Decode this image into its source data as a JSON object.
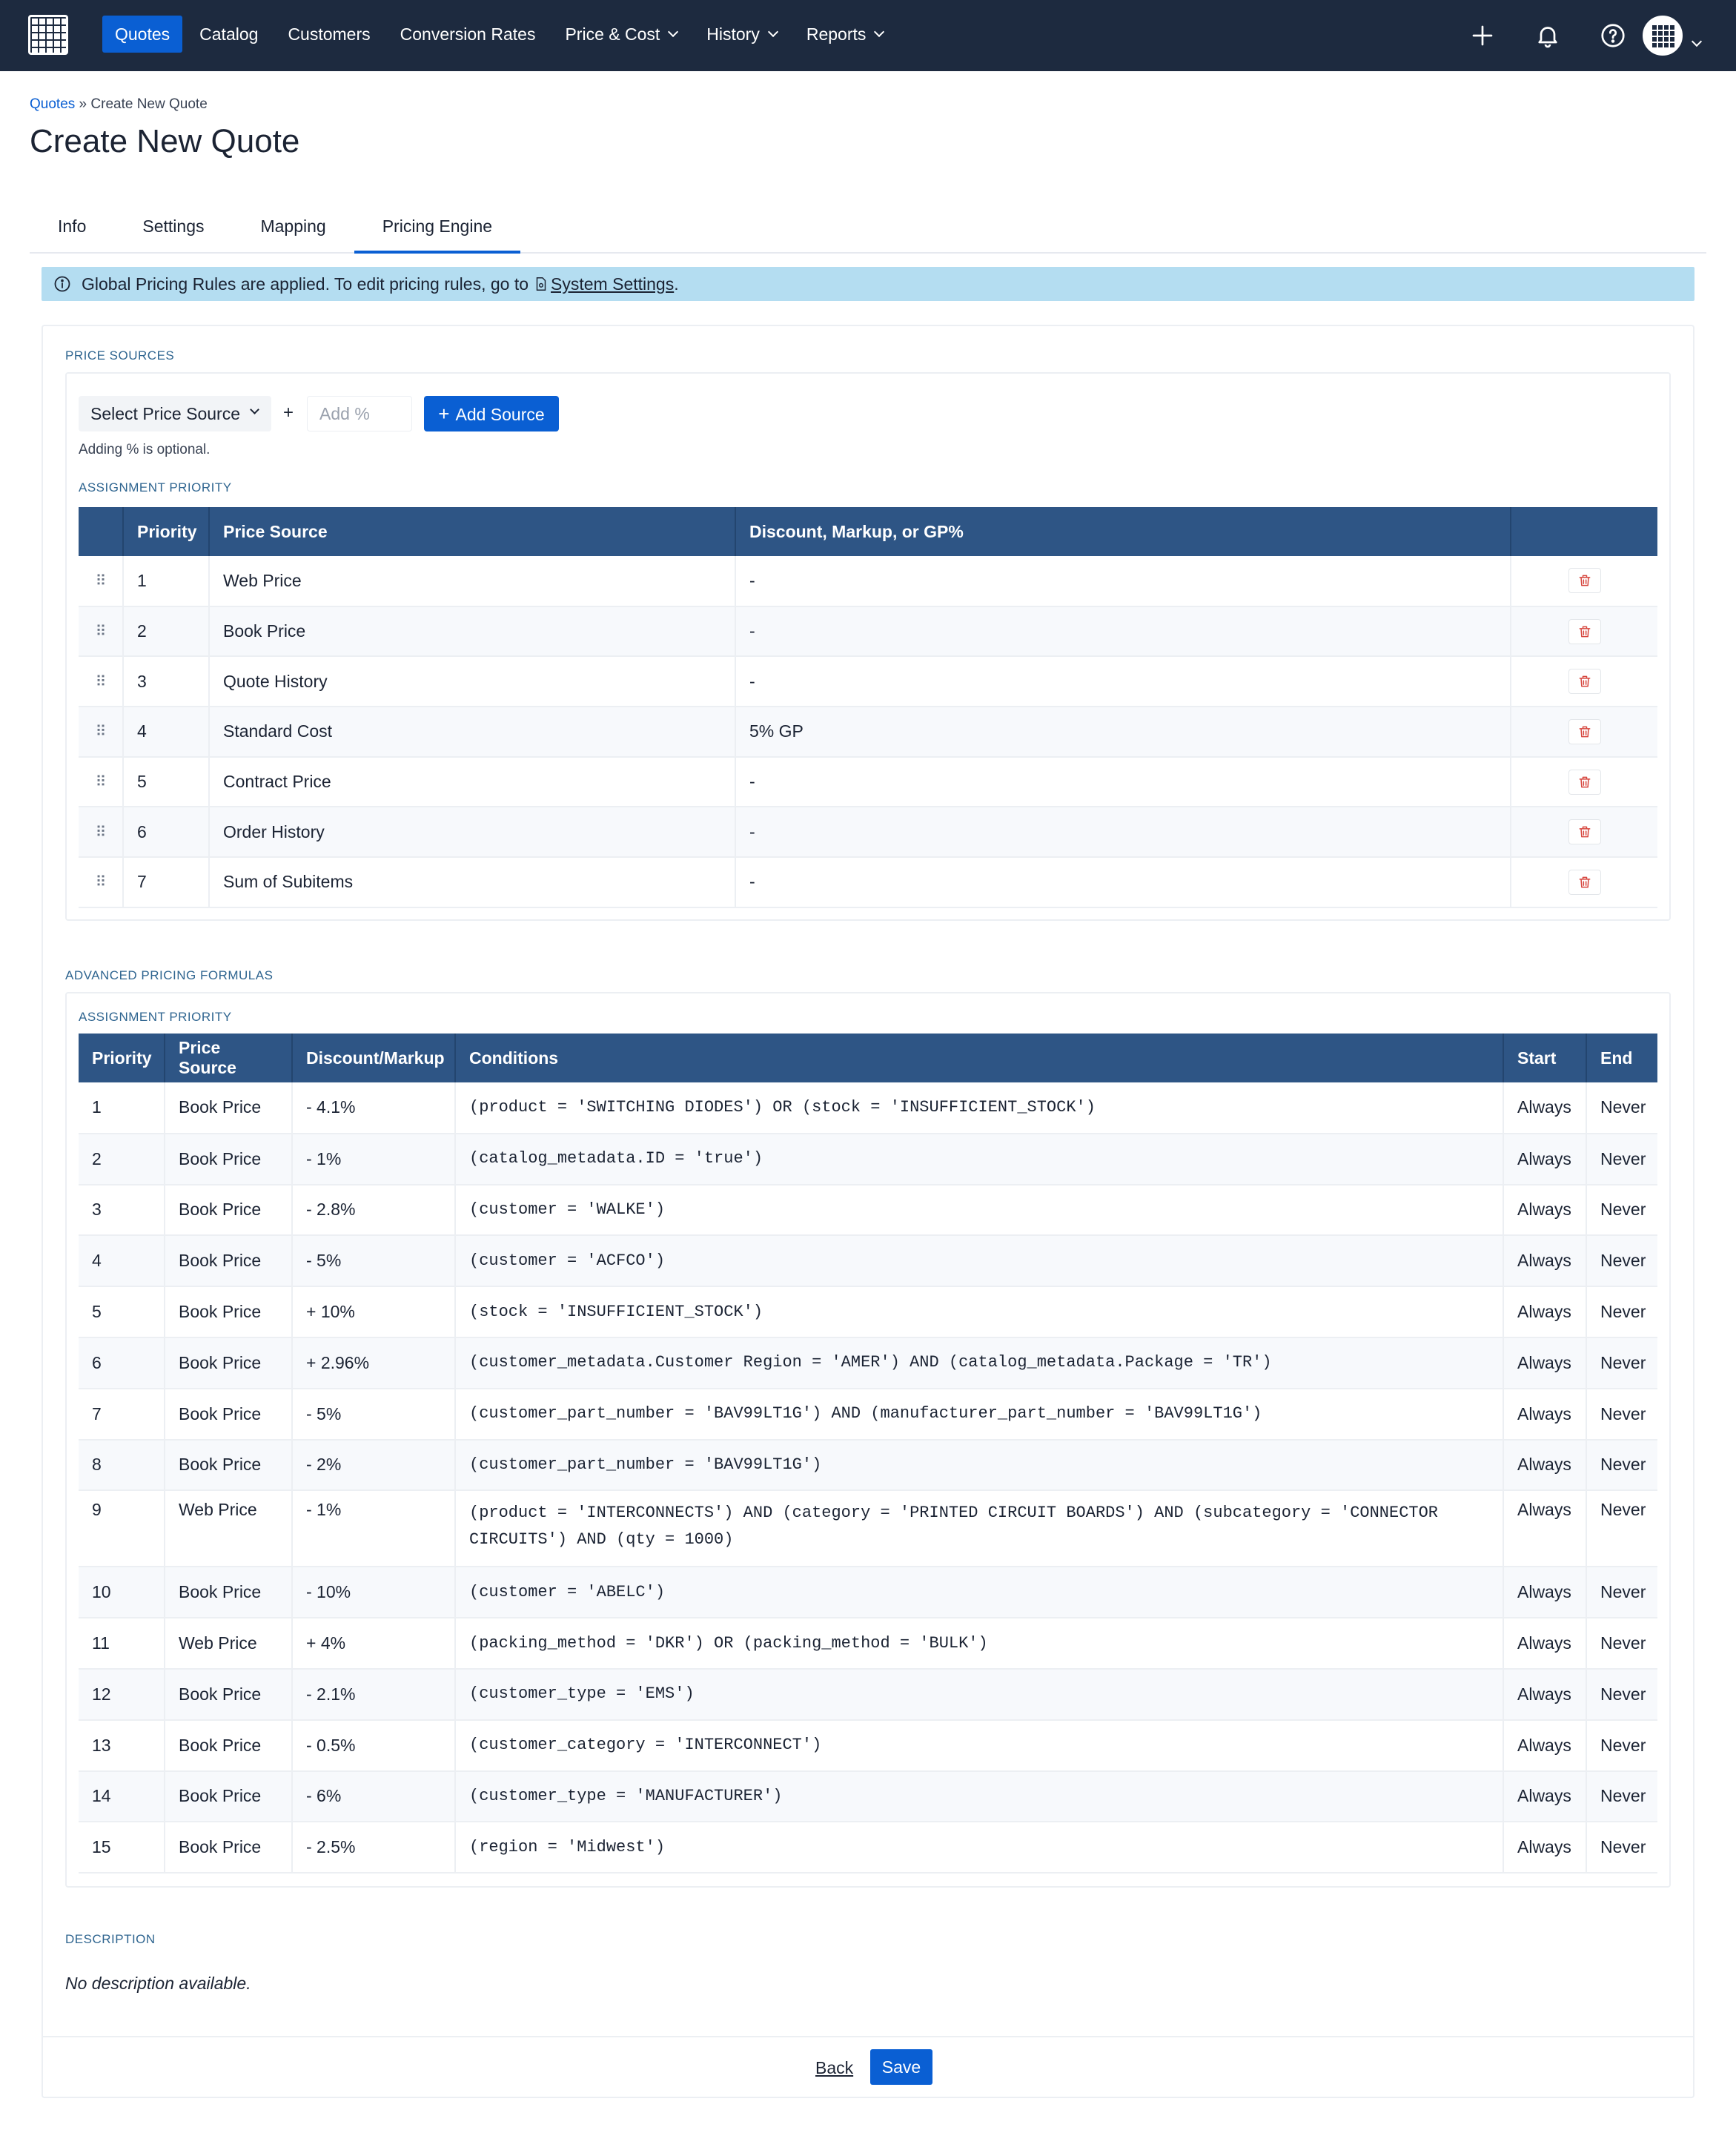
{
  "nav": {
    "items": [
      {
        "label": "Quotes",
        "active": true,
        "dropdown": false
      },
      {
        "label": "Catalog",
        "active": false,
        "dropdown": false
      },
      {
        "label": "Customers",
        "active": false,
        "dropdown": false
      },
      {
        "label": "Conversion Rates",
        "active": false,
        "dropdown": false
      },
      {
        "label": "Price & Cost",
        "active": false,
        "dropdown": true
      },
      {
        "label": "History",
        "active": false,
        "dropdown": true
      },
      {
        "label": "Reports",
        "active": false,
        "dropdown": true
      }
    ],
    "icons": [
      "plus-icon",
      "bell-icon",
      "help-icon",
      "avatar"
    ]
  },
  "breadcrumb": {
    "root": "Quotes",
    "separator": "»",
    "current": "Create New Quote"
  },
  "page_title": "Create New Quote",
  "tabs": [
    {
      "label": "Info",
      "active": false
    },
    {
      "label": "Settings",
      "active": false
    },
    {
      "label": "Mapping",
      "active": false
    },
    {
      "label": "Pricing Engine",
      "active": true
    }
  ],
  "alert": {
    "text": "Global Pricing Rules are applied. To edit pricing rules, go to",
    "link": "System Settings",
    "suffix": "."
  },
  "price_sources": {
    "label": "PRICE SOURCES",
    "select_label": "Select Price Source",
    "plus": "+",
    "add_pct_placeholder": "Add %",
    "add_button": "Add Source",
    "hint": "Adding % is optional.",
    "priority_label": "ASSIGNMENT PRIORITY",
    "columns": [
      "",
      "Priority",
      "Price Source",
      "Discount, Markup, or GP%",
      ""
    ],
    "rows": [
      {
        "priority": "1",
        "source": "Web Price",
        "adjust": "-"
      },
      {
        "priority": "2",
        "source": "Book Price",
        "adjust": "-"
      },
      {
        "priority": "3",
        "source": "Quote History",
        "adjust": "-"
      },
      {
        "priority": "4",
        "source": "Standard Cost",
        "adjust": "5% GP"
      },
      {
        "priority": "5",
        "source": "Contract Price",
        "adjust": "-"
      },
      {
        "priority": "6",
        "source": "Order History",
        "adjust": "-"
      },
      {
        "priority": "7",
        "source": "Sum of Subitems",
        "adjust": "-"
      }
    ]
  },
  "formulas": {
    "label": "ADVANCED PRICING FORMULAS",
    "priority_label": "ASSIGNMENT PRIORITY",
    "columns": [
      "Priority",
      "Price Source",
      "Discount/Markup",
      "Conditions",
      "Start",
      "End"
    ],
    "rows": [
      {
        "priority": "1",
        "source": "Book Price",
        "adjust": "- 4.1%",
        "conditions": "(product = 'SWITCHING DIODES') OR (stock = 'INSUFFICIENT_STOCK')",
        "start": "Always",
        "end": "Never"
      },
      {
        "priority": "2",
        "source": "Book Price",
        "adjust": "- 1%",
        "conditions": "(catalog_metadata.ID = 'true')",
        "start": "Always",
        "end": "Never"
      },
      {
        "priority": "3",
        "source": "Book Price",
        "adjust": "- 2.8%",
        "conditions": "(customer = 'WALKE')",
        "start": "Always",
        "end": "Never"
      },
      {
        "priority": "4",
        "source": "Book Price",
        "adjust": "- 5%",
        "conditions": "(customer = 'ACFCO')",
        "start": "Always",
        "end": "Never"
      },
      {
        "priority": "5",
        "source": "Book Price",
        "adjust": "+ 10%",
        "conditions": "(stock = 'INSUFFICIENT_STOCK')",
        "start": "Always",
        "end": "Never"
      },
      {
        "priority": "6",
        "source": "Book Price",
        "adjust": "+ 2.96%",
        "conditions": "(customer_metadata.Customer Region = 'AMER') AND (catalog_metadata.Package = 'TR')",
        "start": "Always",
        "end": "Never"
      },
      {
        "priority": "7",
        "source": "Book Price",
        "adjust": "- 5%",
        "conditions": "(customer_part_number = 'BAV99LT1G') AND (manufacturer_part_number = 'BAV99LT1G')",
        "start": "Always",
        "end": "Never"
      },
      {
        "priority": "8",
        "source": "Book Price",
        "adjust": "- 2%",
        "conditions": "(customer_part_number = 'BAV99LT1G')",
        "start": "Always",
        "end": "Never"
      },
      {
        "priority": "9",
        "source": "Web Price",
        "adjust": "- 1%",
        "conditions": "(product = 'INTERCONNECTS') AND (category = 'PRINTED CIRCUIT BOARDS') AND (subcategory = 'CONNECTOR CIRCUITS') AND (qty = 1000)",
        "start": "Always",
        "end": "Never"
      },
      {
        "priority": "10",
        "source": "Book Price",
        "adjust": "- 10%",
        "conditions": "(customer = 'ABELC')",
        "start": "Always",
        "end": "Never"
      },
      {
        "priority": "11",
        "source": "Web Price",
        "adjust": "+ 4%",
        "conditions": "(packing_method = 'DKR') OR (packing_method = 'BULK')",
        "start": "Always",
        "end": "Never"
      },
      {
        "priority": "12",
        "source": "Book Price",
        "adjust": "- 2.1%",
        "conditions": "(customer_type = 'EMS')",
        "start": "Always",
        "end": "Never"
      },
      {
        "priority": "13",
        "source": "Book Price",
        "adjust": "- 0.5%",
        "conditions": "(customer_category = 'INTERCONNECT')",
        "start": "Always",
        "end": "Never"
      },
      {
        "priority": "14",
        "source": "Book Price",
        "adjust": "- 6%",
        "conditions": "(customer_type = 'MANUFACTURER')",
        "start": "Always",
        "end": "Never"
      },
      {
        "priority": "15",
        "source": "Book Price",
        "adjust": "- 2.5%",
        "conditions": "(region = 'Midwest')",
        "start": "Always",
        "end": "Never"
      }
    ]
  },
  "description": {
    "label": "DESCRIPTION",
    "text": "No description available."
  },
  "footer": {
    "back": "Back",
    "save": "Save"
  },
  "colors": {
    "nav_bg": "#1d2a3f",
    "accent": "#0a5fd3",
    "table_header": "#2e5585",
    "alert_bg": "#b4ddf1",
    "delete_red": "#d6453d"
  }
}
